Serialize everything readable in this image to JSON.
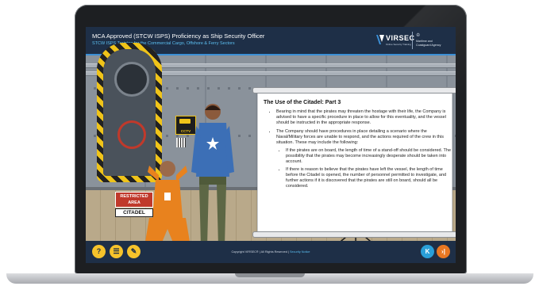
{
  "header": {
    "title": "MCA Approved (STCW ISPS) Proficiency as Ship Security Officer",
    "subtitle": "STCW ISPS Training for the Commercial Cargo, Offshore & Ferry Sectors",
    "brand_name": "VIRSEC",
    "brand_tagline": "Online Security Training",
    "agency_line1": "Maritime and",
    "agency_line2": "Coastguard Agency",
    "agency_crest": "♔"
  },
  "scene": {
    "cctv_label": "CCTV",
    "sign_line1": "RESTRICTED",
    "sign_line2": "AREA",
    "sign_line3": "CITADEL"
  },
  "panel": {
    "title": "The Use of the Citadel: Part 3",
    "bullet1": "Bearing in mind that the pirates may threaten the hostage with their life, the Company is advised to have a specific procedure in place to allow for this eventuality, and the vessel should be instructed in the appropriate response.",
    "bullet2": "The Company should have procedures in place detailing a scenario where the Naval/Military forces are unable to respond, and the actions required of the crew in this situation. These may include the following:",
    "sub1": "If the pirates are on board, the length of time of a stand-off should be considered. The possibility that the pirates may become increasingly desperate should be taken into account.",
    "sub2": "If there is reason to believe that the pirates have left the vessel, the length of time before the Citadel is opened, the number of personnel permitted to investigate, and further actions if it is discovered that the pirates are still on board, should all be considered."
  },
  "footer": {
    "help_label": "?",
    "menu_label": "☰",
    "notes_label": "✎",
    "copyright": "Copyright VIRSEC® | All Rights Reserved |",
    "notice_link": "Security Notice",
    "prev_label": "K",
    "next_label": "›|"
  },
  "colors": {
    "header_bg": "#1e2f47",
    "accent_blue": "#3b8fd6",
    "accent_yellow": "#f6c32b",
    "prev_button": "#2a9fd8",
    "next_button": "#e87722"
  }
}
